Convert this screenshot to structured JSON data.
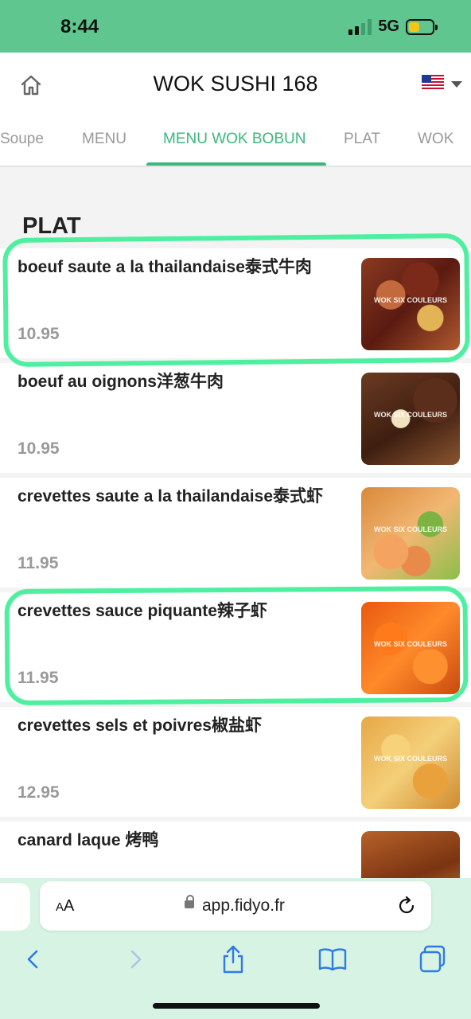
{
  "status_bar": {
    "time": "8:44",
    "network": "5G",
    "battery_level": 0.45
  },
  "header": {
    "title": "WOK SUSHI 168",
    "home_icon": "home-icon",
    "language_flag": "us-flag-icon"
  },
  "tabs": [
    {
      "label": "Soupe",
      "active": false
    },
    {
      "label": "MENU",
      "active": false
    },
    {
      "label": "MENU WOK BOBUN",
      "active": true
    },
    {
      "label": "PLAT",
      "active": false
    },
    {
      "label": "WOK",
      "active": false
    }
  ],
  "section": {
    "title": "PLAT"
  },
  "items": [
    {
      "name": "boeuf saute a la thailandaise泰式牛肉",
      "price": "10.95",
      "image_watermark": "WOK SIX COULEURS"
    },
    {
      "name": "boeuf au oignons洋葱牛肉",
      "price": "10.95",
      "image_watermark": "WOK SIX COULEURS"
    },
    {
      "name": "crevettes saute a la thailandaise泰式虾",
      "price": "11.95",
      "image_watermark": "WOK SIX COULEURS"
    },
    {
      "name": "crevettes sauce piquante辣子虾",
      "price": "11.95",
      "image_watermark": "WOK SIX COULEURS"
    },
    {
      "name": "crevettes sels et poivres椒盐虾",
      "price": "12.95",
      "image_watermark": "WOK SIX COULEURS"
    },
    {
      "name": "canard laque 烤鸭",
      "price": "",
      "image_watermark": ""
    }
  ],
  "browser": {
    "text_size_label_big": "A",
    "text_size_label_small": "A",
    "url": "app.fidyo.fr"
  },
  "colors": {
    "accent": "#3ab87e",
    "status_bar": "#5ec68e",
    "highlight": "#4ef0a0",
    "safari_bar": "#d6f3e4"
  }
}
